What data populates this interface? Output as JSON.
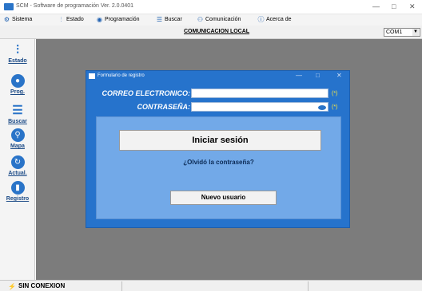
{
  "window": {
    "title": "SCM - Software de programación Ver. 2.0.0401",
    "controls": {
      "minimize": "—",
      "maximize": "□",
      "close": "✕"
    }
  },
  "menu": {
    "items": [
      {
        "label": "Sistema",
        "icon": "gear-icon"
      },
      {
        "label": "Estado",
        "icon": "sliders-icon"
      },
      {
        "label": "Programación",
        "icon": "globe-icon"
      },
      {
        "label": "Buscar",
        "icon": "list-icon"
      },
      {
        "label": "Comunicación",
        "icon": "users-icon"
      },
      {
        "label": "Acerca de",
        "icon": "info-icon"
      }
    ]
  },
  "header": {
    "title": "COMUNICACION LOCAL",
    "com_port": "COM1"
  },
  "sidebar": {
    "items": [
      {
        "label": "Estado",
        "icon": "sliders-icon"
      },
      {
        "label": "Prog.",
        "icon": "globe-icon"
      },
      {
        "label": "Buscar",
        "icon": "list-icon"
      },
      {
        "label": "Mapa",
        "icon": "map-pin-icon"
      },
      {
        "label": "Actual.",
        "icon": "refresh-icon"
      },
      {
        "label": "Registro",
        "icon": "cylinder-icon"
      }
    ]
  },
  "dialog": {
    "title": "Formulario de registro",
    "controls": {
      "minimize": "—",
      "maximize": "□",
      "close": "✕"
    },
    "email_label": "CORREO ELECTRONICO:",
    "email_value": "",
    "password_label": "CONTRASEÑA:",
    "password_value": "",
    "required_marker": "(*)",
    "login_button": "Iniciar sesión",
    "forgot_link": "¿Olvidó la contraseña?",
    "new_user_button": "Nuevo usuario"
  },
  "status": {
    "connection": "SIN  CONEXION"
  },
  "colors": {
    "dialog_bg": "#2673cc",
    "panel_bg": "#72a9e8",
    "workspace_bg": "#7c7c7c",
    "accent": "#2a74c8"
  }
}
